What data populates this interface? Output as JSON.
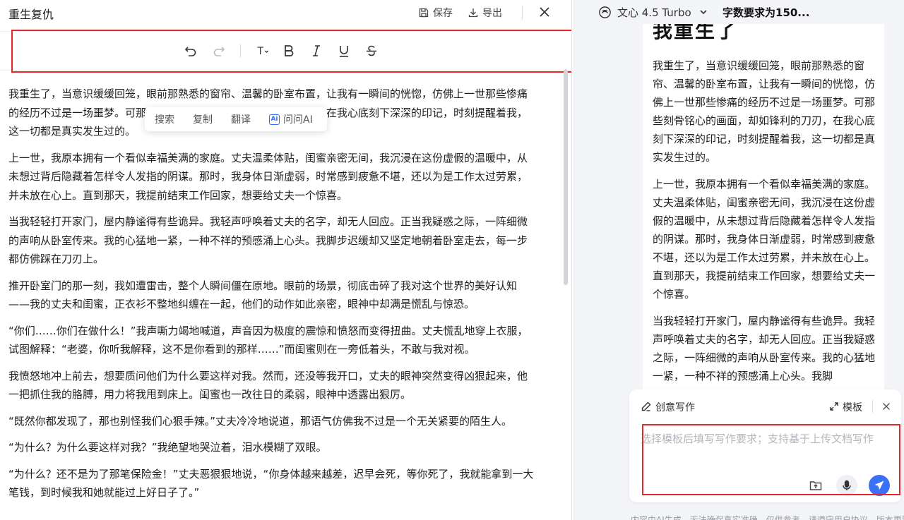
{
  "editor": {
    "title": "重生复仇",
    "save_label": "保存",
    "export_label": "导出"
  },
  "context_menu": {
    "items": [
      "搜索",
      "复制",
      "翻译",
      "问问AI"
    ],
    "ai_badge": "Ai"
  },
  "paragraphs": [
    "我重生了，当意识缓缓回笼，眼前那熟悉的窗帘、温馨的卧室布置，让我有一瞬间的恍惚，仿佛上一世那些惨痛的经历不过是一场噩梦。可那些刻骨铭心的画面，却如锋利的刀刃，在我心底刻下深深的印记，时刻提醒着我，这一切都是真实发生过的。",
    "上一世，我原本拥有一个看似幸福美满的家庭。丈夫温柔体贴，闺蜜亲密无间，我沉浸在这份虚假的温暖中，从未想过背后隐藏着怎样令人发指的阴谋。那时，我身体日渐虚弱，时常感到疲惫不堪，还以为是工作太过劳累，并未放在心上。直到那天，我提前结束工作回家，想要给丈夫一个惊喜。",
    "当我轻轻打开家门，屋内静谧得有些诡异。我轻声呼唤着丈夫的名字，却无人回应。正当我疑惑之际，一阵细微的声响从卧室传来。我的心猛地一紧，一种不祥的预感涌上心头。我脚步迟缓却又坚定地朝着卧室走去，每一步都仿佛踩在刀刃上。",
    "推开卧室门的那一刻，我如遭雷击，整个人瞬间僵在原地。眼前的场景，彻底击碎了我对这个世界的美好认知——我的丈夫和闺蜜，正衣衫不整地纠缠在一起，他们的动作如此亲密，眼神中却满是慌乱与惊恐。",
    "“你们……你们在做什么！”我声嘶力竭地喊道，声音因为极度的震惊和愤怒而变得扭曲。丈夫慌乱地穿上衣服，试图解释：“老婆，你听我解释，这不是你看到的那样……”而闺蜜则在一旁低着头，不敢与我对视。",
    "我愤怒地冲上前去，想要质问他们为什么要这样对我。然而，还没等我开口，丈夫的眼神突然变得凶狠起来，他一把抓住我的胳膊，用力将我甩到床上。闺蜜也一改往日的柔弱，眼神中透露出狠厉。",
    "“既然你都发现了，那也别怪我们心狠手辣。”丈夫冷冷地说道，那语气仿佛我不过是一个无关紧要的陌生人。",
    "“为什么？为什么要这样对我？”我绝望地哭泣着，泪水模糊了双眼。",
    "“为什么？还不是为了那笔保险金！”丈夫恶狠狠地说，“你身体越来越差，迟早会死，等你死了，我就能拿到一大笔钱，到时候我和她就能过上好日子了。”"
  ],
  "assistant": {
    "model_name": "文心 4.5 Turbo",
    "chat_title": "字数要求为150...",
    "preview_heading": "我重生了",
    "preview_paragraphs": [
      "我重生了，当意识缓缓回笼，眼前那熟悉的窗帘、温馨的卧室布置，让我有一瞬间的恍惚，仿佛上一世那些惨痛的经历不过是一场噩梦。可那些刻骨铭心的画面，却如锋利的刀刃，在我心底刻下深深的印记，时刻提醒着我，这一切都是真实发生过的。",
      "上一世，我原本拥有一个看似幸福美满的家庭。丈夫温柔体贴，闺蜜亲密无间，我沉浸在这份虚假的温暖中，从未想过背后隐藏着怎样令人发指的阴谋。那时，我身体日渐虚弱，时常感到疲惫不堪，还以为是工作太过劳累，并未放在心上。直到那天，我提前结束工作回家，想要给丈夫一个惊喜。",
      "当我轻轻打开家门，屋内静谧得有些诡异。我轻声呼唤着丈夫的名字，却无人回应。正当我疑惑之际，一阵细微的声响从卧室传来。我的心猛地一紧，一种不祥的预感涌上心头。我脚"
    ]
  },
  "composer": {
    "mode_label": "创意写作",
    "template_label": "模板",
    "placeholder": "选择模板后填写写作要求；支持基于上传文档写作"
  },
  "disclaimer": "内容由AI生成，无法确保真实准确，仅供参考，请遵守用户协议，版本更新"
}
